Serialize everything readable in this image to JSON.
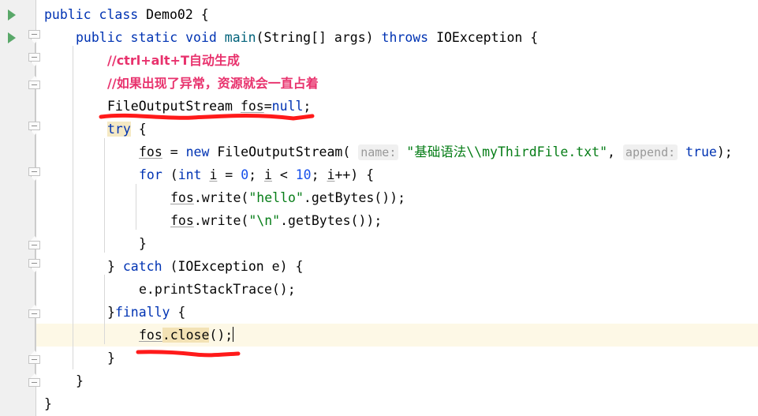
{
  "editor": {
    "language": "java",
    "theme": "IntelliJ Light",
    "colors": {
      "keyword": "#0033B3",
      "class_name": "#000000",
      "method": "#00627A",
      "string": "#067D17",
      "number": "#1750EB",
      "comment_highlight": "#E8326D",
      "param_hint_text": "#999999",
      "param_hint_bg": "#F0F0F0",
      "caret_line_bg": "#FDF8E6",
      "keyword_highlight_bg": "#F5E9C4",
      "identifier_highlight_bg": "#F3E2B5",
      "gutter_bg": "#F0F0F0",
      "fold_marker": "#C4C4C4",
      "run_arrow": "#59A869",
      "annotation_red": "#FF1A1A",
      "indent_guide": "#D8D8D8",
      "editor_bg": "#FFFFFF"
    }
  },
  "gutter": {
    "run_arrows": [
      {
        "name": "run-class-arrow",
        "line": 1,
        "tooltip": "Run"
      },
      {
        "name": "run-method-arrow",
        "line": 2,
        "tooltip": "Run"
      }
    ],
    "fold_markers": [
      {
        "line": 2,
        "type": "fold-start"
      },
      {
        "line": 3,
        "type": "fold-start"
      },
      {
        "line": 4,
        "type": "fold-end"
      },
      {
        "line": 6,
        "type": "fold-start"
      },
      {
        "line": 8,
        "type": "fold-start"
      },
      {
        "line": 11,
        "type": "fold-end"
      },
      {
        "line": 12,
        "type": "fold-start"
      },
      {
        "line": 14,
        "type": "fold-end"
      },
      {
        "line": 16,
        "type": "fold-end"
      },
      {
        "line": 17,
        "type": "fold-end"
      }
    ]
  },
  "code": {
    "caret_line": 15,
    "caret_column_after": "fos.close();",
    "lines": [
      {
        "n": 1,
        "indent": 0,
        "text": "public class Demo02 {"
      },
      {
        "n": 2,
        "indent": 1,
        "text": "public static void main(String[] args) throws IOException {"
      },
      {
        "n": 3,
        "indent": 2,
        "text": "//ctrl+alt+T自动生成"
      },
      {
        "n": 4,
        "indent": 2,
        "text": "//如果出现了异常，资源就会一直占着"
      },
      {
        "n": 5,
        "indent": 2,
        "text": "FileOutputStream fos=null;"
      },
      {
        "n": 6,
        "indent": 2,
        "text": "try {"
      },
      {
        "n": 7,
        "indent": 3,
        "text": "fos = new FileOutputStream( name: \"基础语法\\\\myThirdFile.txt\", append: true);"
      },
      {
        "n": 8,
        "indent": 3,
        "text": "for (int i = 0; i < 10; i++) {"
      },
      {
        "n": 9,
        "indent": 4,
        "text": "fos.write(\"hello\".getBytes());"
      },
      {
        "n": 10,
        "indent": 4,
        "text": "fos.write(\"\\n\".getBytes());"
      },
      {
        "n": 11,
        "indent": 3,
        "text": "}"
      },
      {
        "n": 12,
        "indent": 2,
        "text": "} catch (IOException e) {"
      },
      {
        "n": 13,
        "indent": 3,
        "text": "e.printStackTrace();"
      },
      {
        "n": 14,
        "indent": 2,
        "text": "}finally {"
      },
      {
        "n": 15,
        "indent": 3,
        "text": "fos.close();"
      },
      {
        "n": 16,
        "indent": 2,
        "text": "}"
      },
      {
        "n": 17,
        "indent": 1,
        "text": "}"
      },
      {
        "n": 18,
        "indent": 0,
        "text": "}"
      }
    ],
    "tokens": {
      "kw_public": "public",
      "kw_class": "class",
      "kw_static": "static",
      "kw_void": "void",
      "kw_throws": "throws",
      "kw_try": "try",
      "kw_catch": "catch",
      "kw_finally": "finally",
      "kw_new": "new",
      "kw_int": "int",
      "kw_null": "null",
      "kw_true": "true",
      "kw_for": "for",
      "type_demo02": "Demo02",
      "type_string": "String",
      "type_ioexception": "IOException",
      "type_fos_class": "FileOutputStream",
      "method_main": "main",
      "var_args": "args",
      "var_fos": "fos",
      "var_i": "i",
      "var_e": "e",
      "method_write": "write",
      "method_getbytes": "getBytes",
      "method_printstacktrace": "printStackTrace",
      "method_close": "close",
      "hint_name": "name:",
      "hint_append": "append:",
      "str_filepath": "\"基础语法\\\\myThirdFile.txt\"",
      "str_hello": "\"hello\"",
      "str_newline": "\"\\n\"",
      "num_zero": "0",
      "num_ten": "10",
      "comment_1": "//ctrl+alt+T自动生成",
      "comment_2": "//如果出现了异常，资源就会一直占着"
    }
  },
  "annotations": [
    {
      "name": "red-underline-declaration",
      "target_line": 5,
      "color": "#FF1A1A",
      "note": "hand-drawn underline beneath FileOutputStream fos=null;"
    },
    {
      "name": "red-underline-close",
      "target_line": 16,
      "color": "#FF1A1A",
      "note": "hand-drawn underline beneath closing brace after fos.close();"
    }
  ]
}
